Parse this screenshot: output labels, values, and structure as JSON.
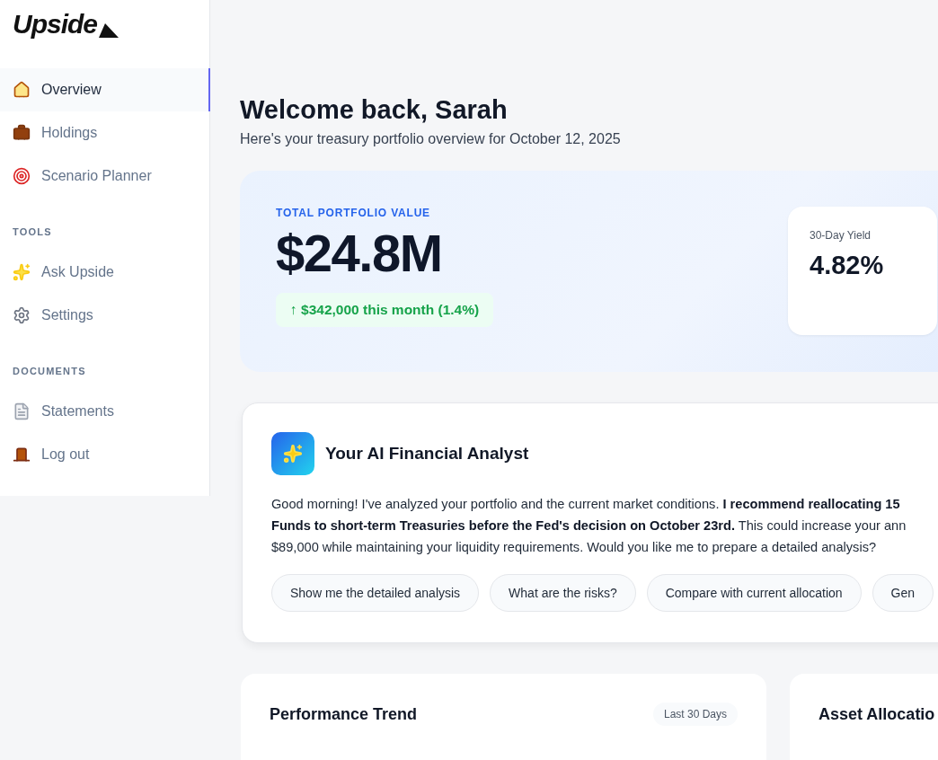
{
  "logo": {
    "text": "Upside"
  },
  "sidebar": {
    "sections": [
      {
        "items": [
          {
            "label": "Overview",
            "selected": true
          },
          {
            "label": "Holdings",
            "selected": false
          },
          {
            "label": "Scenario Planner",
            "selected": false
          }
        ]
      },
      {
        "heading": "TOOLS",
        "items": [
          {
            "label": "Ask Upside",
            "selected": false
          },
          {
            "label": "Settings",
            "selected": false
          }
        ]
      },
      {
        "heading": "DOCUMENTS",
        "items": [
          {
            "label": "Statements",
            "selected": false
          },
          {
            "label": "Log out",
            "selected": false
          }
        ]
      }
    ]
  },
  "header": {
    "title": "Welcome back, Sarah",
    "subtitle": "Here's your treasury portfolio overview for October 12, 2025"
  },
  "portfolio": {
    "label": "TOTAL PORTFOLIO VALUE",
    "value": "$24.8M",
    "change": "↑ $342,000 this month (1.4%)",
    "stats": [
      {
        "label": "30-Day Yield",
        "value": "4.82%"
      }
    ]
  },
  "analyst": {
    "title": "Your AI Financial Analyst",
    "message_lines": [
      "Good morning! I've analyzed your portfolio and the current market conditions. **I recommend reallocating 15**",
      "**Funds to short-term Treasuries before the Fed's decision on October 23rd.** This could increase your ann",
      "$89,000 while maintaining your liquidity requirements. Would you like me to prepare a detailed analysis?"
    ],
    "suggestions": [
      "Show me the detailed analysis",
      "What are the risks?",
      "Compare with current allocation",
      "Gen"
    ]
  },
  "cards": [
    {
      "title": "Performance Trend",
      "badge": "Last 30 Days"
    },
    {
      "title": "Asset Allocatio"
    }
  ]
}
